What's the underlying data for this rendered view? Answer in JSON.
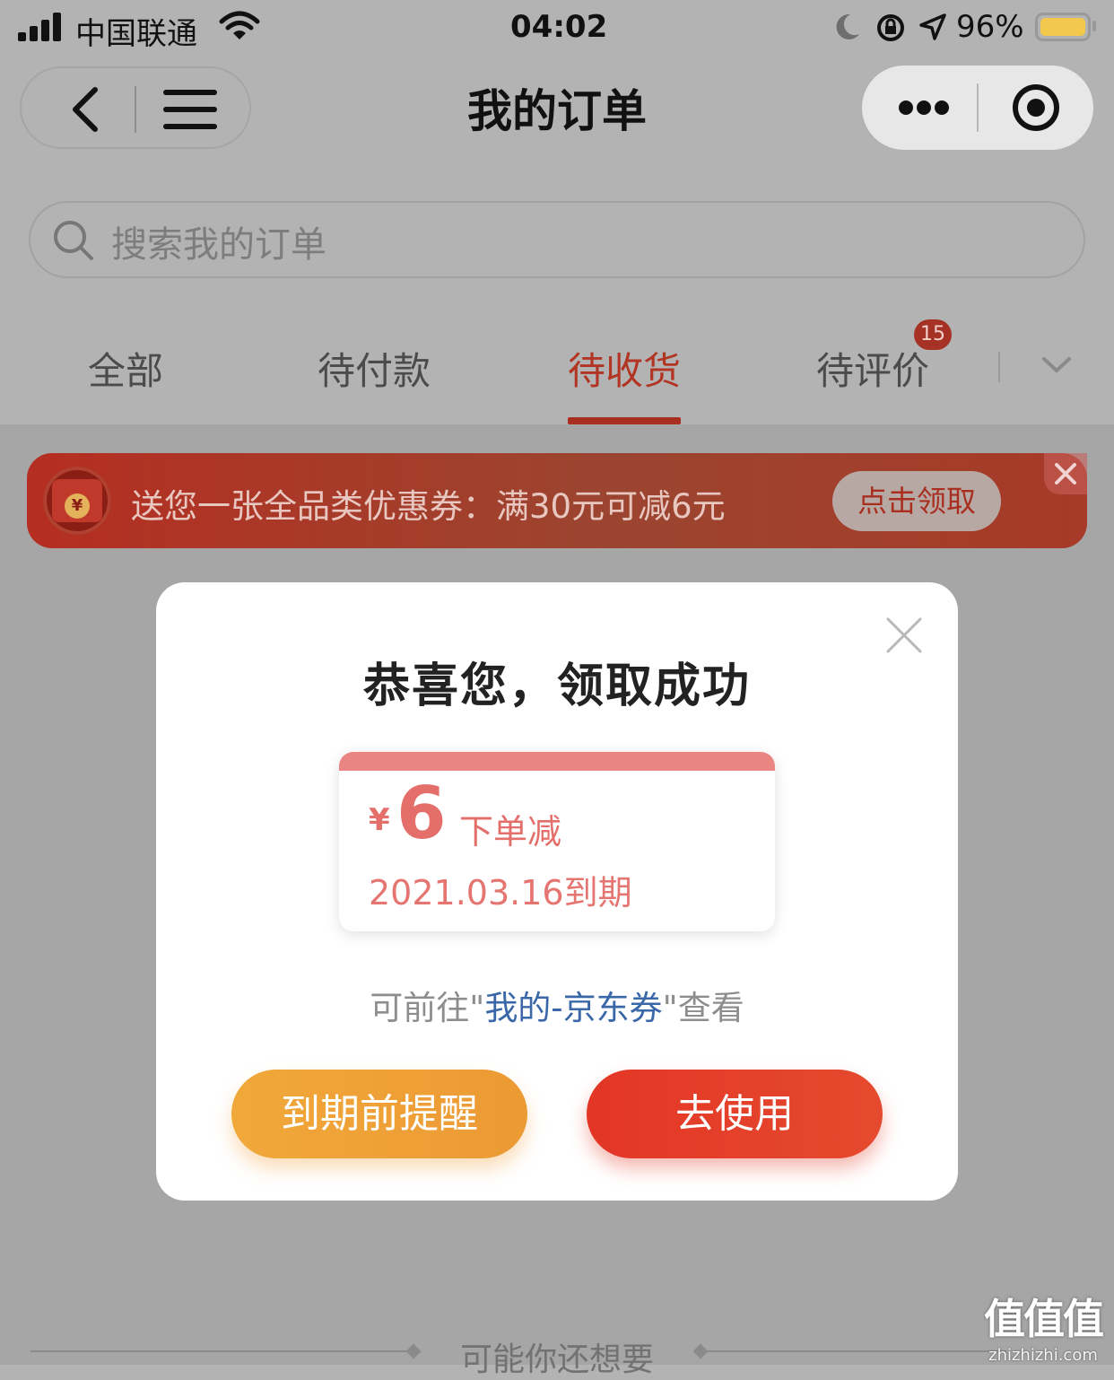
{
  "status_bar": {
    "carrier": "中国联通",
    "time": "04:02",
    "battery": "96%"
  },
  "header": {
    "title": "我的订单"
  },
  "search": {
    "placeholder": "搜索我的订单"
  },
  "tabs": [
    {
      "label": "全部"
    },
    {
      "label": "待付款"
    },
    {
      "label": "待收货",
      "active": true
    },
    {
      "label": "待评价",
      "badge": "15"
    }
  ],
  "banner": {
    "text": "送您一张全品类优惠券：满30元可减6元",
    "button": "点击领取",
    "icon_symbol": "¥"
  },
  "modal": {
    "title": "恭喜您，领取成功",
    "coupon": {
      "currency": "¥",
      "amount": "6",
      "label": "下单减",
      "expiry": "2021.03.16到期"
    },
    "hint_prefix": "可前往\"",
    "hint_link": "我的-京东券",
    "hint_suffix": "\"查看",
    "remind_button": "到期前提醒",
    "use_button": "去使用"
  },
  "recommend": {
    "title": "可能你还想要"
  },
  "watermark": {
    "main": "值值值",
    "domain": "zhizhizhi.com"
  },
  "colors": {
    "accent": "#e33626",
    "orange": "#f1a83a",
    "coupon": "#e46f6a",
    "link": "#3a67a8"
  }
}
